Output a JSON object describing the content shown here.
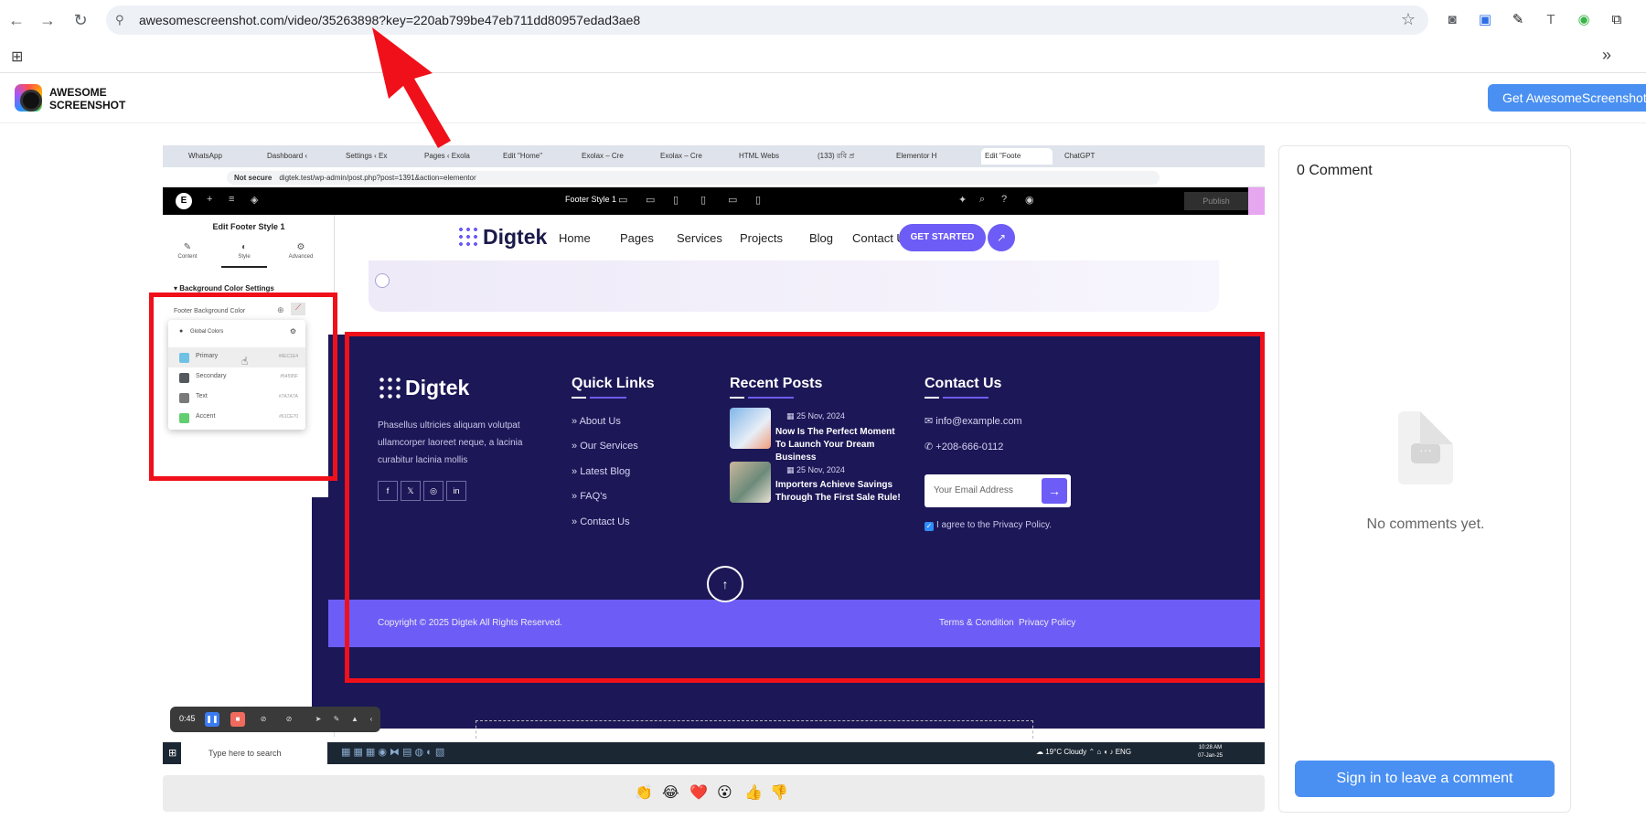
{
  "browser": {
    "url": "awesomescreenshot.com/video/35263898?key=220ab799be47eb711dd80957edad3ae8"
  },
  "awesome": {
    "brand_line1": "AWESOME",
    "brand_line2": "SCREENSHOT",
    "get_button": "Get AwesomeScreenshot"
  },
  "video": {
    "inner_tabs": [
      "WhatsApp",
      "Dashboard ‹",
      "Settings ‹ Ex",
      "Pages ‹ Exola",
      "Edit \"Home\"",
      "Exolax – Cre",
      "Exolax – Cre",
      "HTML Webs",
      "(133) রবি প্র",
      "Elementor H",
      "Edit \"Foote",
      "ChatGPT"
    ],
    "not_secure": "Not secure",
    "inner_url": "digtek.test/wp-admin/post.php?post=1391&action=elementor",
    "elementor": {
      "footer_style": "Footer Style 1",
      "publish": "Publish",
      "panel_title": "Edit Footer Style 1",
      "tabs": [
        "Content",
        "Style",
        "Advanced"
      ],
      "bg_section_title": "Background Color Settings",
      "bg_label": "Footer Background Color",
      "global_colors_title": "Global Colors",
      "global_colors": [
        {
          "name": "Primary",
          "hex": "#6EC1E4",
          "color": "#6ec1e4"
        },
        {
          "name": "Secondary",
          "hex": "#54595F",
          "color": "#54595f"
        },
        {
          "name": "Text",
          "hex": "#7A7A7A",
          "color": "#7a7a7a"
        },
        {
          "name": "Accent",
          "hex": "#61CE70",
          "color": "#61ce70"
        }
      ]
    },
    "site": {
      "logo": "Digtek",
      "nav": [
        "Home",
        "Pages",
        "Services",
        "Projects",
        "Blog",
        "Contact Us"
      ],
      "cta": "GET STARTED"
    },
    "footer": {
      "logo": "Digtek",
      "about": "Phasellus ultricies aliquam volutpat ullamcorper laoreet neque, a lacinia curabitur lacinia mollis",
      "quick_links_title": "Quick Links",
      "quick_links": [
        "About Us",
        "Our Services",
        "Latest Blog",
        "FAQ's",
        "Contact Us"
      ],
      "recent_posts_title": "Recent Posts",
      "posts": [
        {
          "date": "25 Nov, 2024",
          "title": "Now Is The Perfect Moment To Launch Your Dream Business"
        },
        {
          "date": "25 Nov, 2024",
          "title": "Importers Achieve Savings Through The First Sale Rule!"
        }
      ],
      "contact_title": "Contact Us",
      "email": "info@example.com",
      "phone": "+208-666-0112",
      "email_placeholder": "Your Email Address",
      "agree": "I agree to the Privacy Policy.",
      "copyright": "Copyright © 2025 Digtek All Rights Reserved.",
      "terms": "Terms & Condition",
      "privacy": "Privacy Policy"
    },
    "recorder_time": "0:45",
    "taskbar": {
      "search": "Type here to search",
      "weather": "19°C  Cloudy",
      "lang": "ENG",
      "time": "10:28 AM",
      "date": "07-Jan-25"
    }
  },
  "reactions": [
    "👏",
    "😂",
    "❤️",
    "😮",
    "👍",
    "👎"
  ],
  "comments": {
    "count_label": "0 Comment",
    "empty": "No comments yet.",
    "sign_in": "Sign in to leave a comment"
  },
  "colors": {
    "footer_bg": "#1c1757",
    "accent": "#6d5cf6",
    "highlight": "#f0101a",
    "button_blue": "#4a90f2"
  }
}
